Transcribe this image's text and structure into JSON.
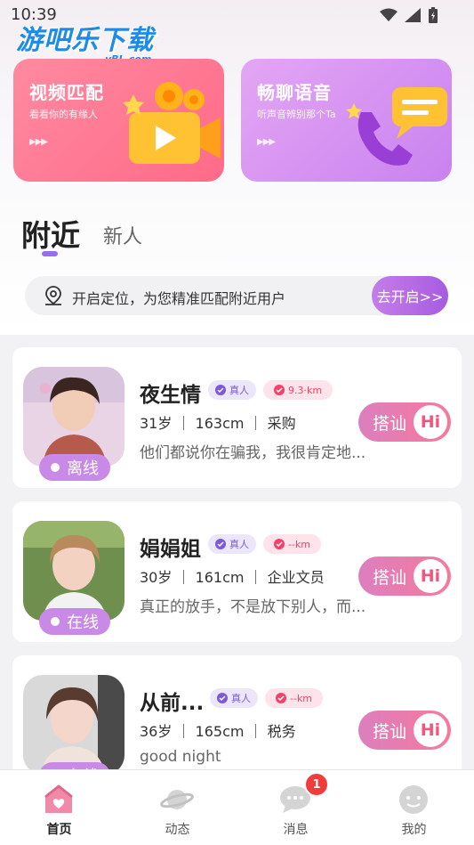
{
  "status_bar": {
    "time": "10:39"
  },
  "watermark": {
    "text": "游吧乐下载",
    "sub": "yBL.com"
  },
  "features": [
    {
      "title": "视频匹配",
      "subtitle": "看看你的有缘人"
    },
    {
      "title": "畅聊语音",
      "subtitle": "听声音辨别那个Ta"
    }
  ],
  "tabs": [
    {
      "label": "附近"
    },
    {
      "label": "新人"
    }
  ],
  "location_bar": {
    "text": "开启定位，为您精准匹配附近用户",
    "button": "去开启>>"
  },
  "users": [
    {
      "name": "夜生情",
      "real_label": "真人",
      "distance": "9.3·km",
      "info": "31岁 ｜ 163cm ｜ 采购",
      "signature": "他们都说你在骗我，我很肯定地...",
      "status": "离线",
      "chat_label": "搭讪",
      "hi": "Hi"
    },
    {
      "name": "娟娟姐",
      "real_label": "真人",
      "distance": "--km",
      "info": "30岁 ｜ 161cm ｜ 企业文员",
      "signature": "真正的放手，不是放下别人，而...",
      "status": "在线",
      "chat_label": "搭讪",
      "hi": "Hi"
    },
    {
      "name": "从前...",
      "real_label": "真人",
      "distance": "--km",
      "info": "36岁 ｜ 165cm ｜ 税务",
      "signature": "good night",
      "status": "在线",
      "chat_label": "搭讪",
      "hi": "Hi"
    }
  ],
  "bottom_nav": [
    {
      "label": "首页",
      "icon": "home-icon"
    },
    {
      "label": "动态",
      "icon": "planet-icon"
    },
    {
      "label": "消息",
      "icon": "chat-bubble-icon"
    },
    {
      "label": "我的",
      "icon": "profile-icon"
    }
  ],
  "message_badge": "1",
  "colors": {
    "accent": "#9a6cf0",
    "pink": "#f7799c",
    "video_card": "#ff6a88",
    "voice_card": "#c982ef"
  }
}
